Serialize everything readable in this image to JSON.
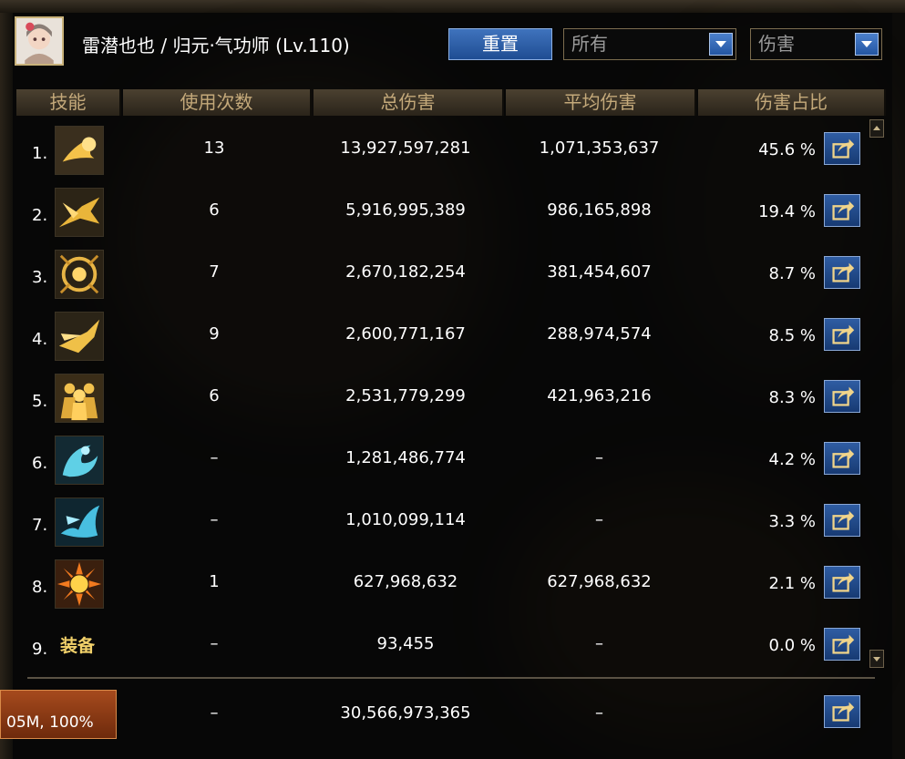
{
  "header": {
    "title": "雷潜也也 / 归元·气功师 (Lv.110)",
    "reset_button": "重置",
    "filter_select": "所有",
    "metric_select": "伤害"
  },
  "columns": [
    "技能",
    "使用次数",
    "总伤害",
    "平均伤害",
    "伤害占比"
  ],
  "rows": [
    {
      "index": "1.",
      "icon": "fireball-skill-icon",
      "uses": "13",
      "total": "13,927,597,281",
      "avg": "1,071,353,637",
      "pct": "45.6 %"
    },
    {
      "index": "2.",
      "icon": "dragon-strike-skill-icon",
      "uses": "6",
      "total": "5,916,995,389",
      "avg": "986,165,898",
      "pct": "19.4 %"
    },
    {
      "index": "3.",
      "icon": "energy-orb-skill-icon",
      "uses": "7",
      "total": "2,670,182,254",
      "avg": "381,454,607",
      "pct": "8.7 %"
    },
    {
      "index": "4.",
      "icon": "flying-kick-skill-icon",
      "uses": "9",
      "total": "2,600,771,167",
      "avg": "288,974,574",
      "pct": "8.5 %"
    },
    {
      "index": "5.",
      "icon": "shadow-clone-skill-icon",
      "uses": "6",
      "total": "2,531,779,299",
      "avg": "421,963,216",
      "pct": "8.3 %"
    },
    {
      "index": "6.",
      "icon": "water-spin-skill-icon",
      "uses": "–",
      "total": "1,281,486,774",
      "avg": "–",
      "pct": "4.2 %"
    },
    {
      "index": "7.",
      "icon": "water-dragon-skill-icon",
      "uses": "–",
      "total": "1,010,099,114",
      "avg": "–",
      "pct": "3.3 %"
    },
    {
      "index": "8.",
      "icon": "sun-burst-skill-icon",
      "uses": "1",
      "total": "627,968,632",
      "avg": "627,968,632",
      "pct": "2.1 %"
    },
    {
      "index": "9.",
      "equip_label": "装备",
      "uses": "–",
      "total": "93,455",
      "avg": "–",
      "pct": "0.0 %"
    }
  ],
  "total_row": {
    "uses": "–",
    "total": "30,566,973,365",
    "avg": "–"
  },
  "zoom_badge": "05M, 100%",
  "colors": {
    "header_text": "#c4a97a",
    "accent_blue": "#2f5da3",
    "equip_gold": "#f2d16a",
    "frame_gold": "#7c6d4f"
  }
}
